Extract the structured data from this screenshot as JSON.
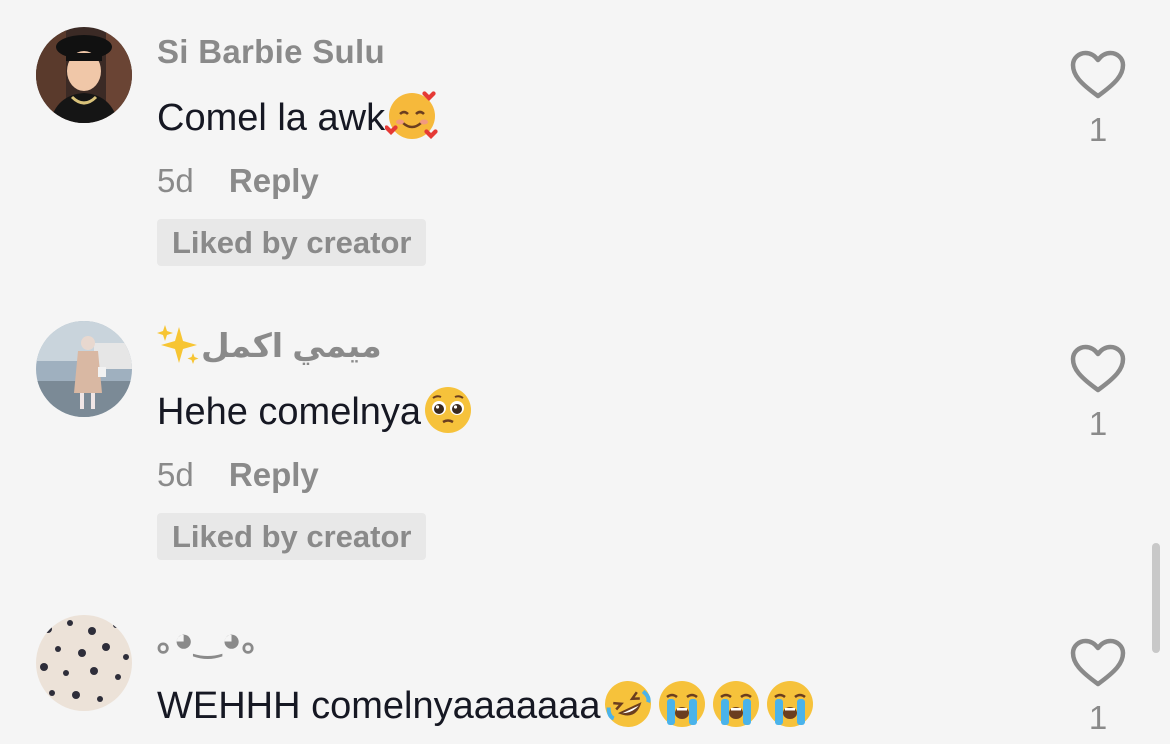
{
  "comments": [
    {
      "username": "Si Barbie Sulu",
      "text": "Comel la awk",
      "emoji": "smiling-face-with-hearts",
      "age": "5d",
      "reply_label": "Reply",
      "badge": "Liked by creator",
      "like_count": "1"
    },
    {
      "username": "ميمي اكمل",
      "username_emoji": "sparkles",
      "text": "Hehe comelnya",
      "emoji": "pleading-face",
      "age": "5d",
      "reply_label": "Reply",
      "badge": "Liked by creator",
      "like_count": "1"
    },
    {
      "username": "｡◕‿◕｡",
      "text": "WEHHH comelnyaaaaaaa",
      "emoji": [
        "rolling-on-floor-laughing",
        "loudly-crying-face",
        "loudly-crying-face",
        "loudly-crying-face"
      ],
      "like_count": "1"
    }
  ],
  "colors": {
    "background": "#f5f5f5",
    "text_primary": "#161823",
    "text_secondary": "#8a8a8a",
    "badge_bg": "#e8e8e8"
  }
}
